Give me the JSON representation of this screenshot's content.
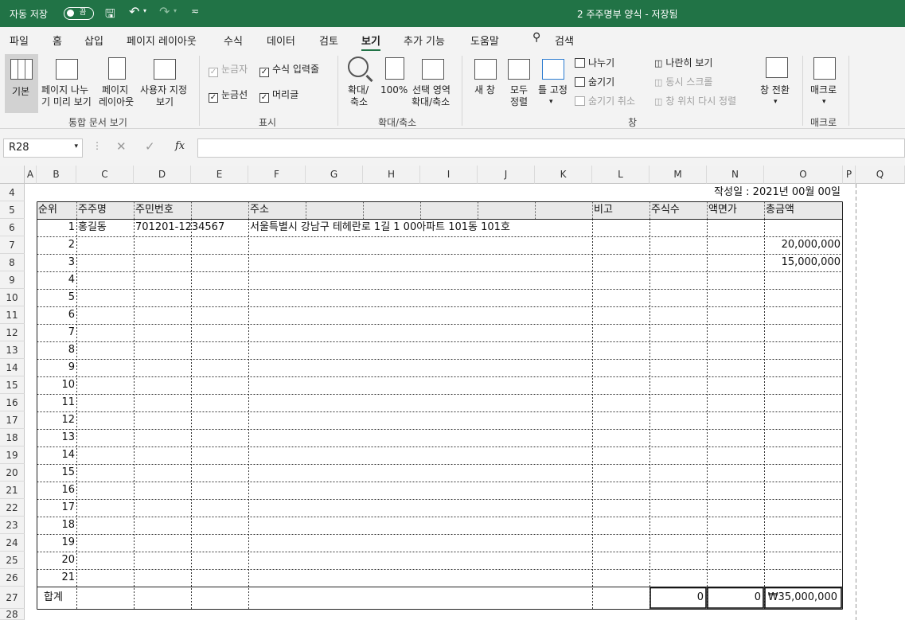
{
  "titlebar": {
    "autosave_label": "자동 저장",
    "toggle_state": "끔",
    "document_title": "2 주주명부 양식 - 저장됨"
  },
  "menu_tabs": [
    "파일",
    "홈",
    "삽입",
    "페이지 레이아웃",
    "수식",
    "데이터",
    "검토",
    "보기",
    "추가 기능",
    "도움말"
  ],
  "search_label": "검색",
  "active_tab": "보기",
  "ribbon": {
    "views": {
      "normal": "기본",
      "page_break": [
        "페이지 나누",
        "기 미리 보기"
      ],
      "page_layout": [
        "페이지",
        "레이아웃"
      ],
      "custom": [
        "사용자 지정",
        "보기"
      ],
      "group": "통합 문서 보기"
    },
    "show": {
      "ruler": "눈금자",
      "formula_bar": "수식 입력줄",
      "gridlines": "눈금선",
      "headings": "머리글",
      "group": "표시"
    },
    "zoom": {
      "zoom": [
        "확대/",
        "축소"
      ],
      "hundred": "100%",
      "selection": [
        "선택 영역",
        "확대/축소"
      ],
      "group": "확대/축소"
    },
    "window": {
      "new_window": "새 창",
      "arrange": [
        "모두",
        "정렬"
      ],
      "freeze": "틀 고정",
      "split": "나누기",
      "hide": "숨기기",
      "unhide": "숨기기 취소",
      "side_by_side": "나란히 보기",
      "sync_scroll": "동시 스크롤",
      "reset_pos": "창 위치 다시 정렬",
      "switch": "창 전환",
      "group": "창"
    },
    "macros": {
      "macro": "매크로",
      "group": "매크로"
    }
  },
  "formula_bar": {
    "name_box": "R28",
    "fx": "fx"
  },
  "columns": [
    "A",
    "B",
    "C",
    "D",
    "E",
    "F",
    "G",
    "H",
    "I",
    "J",
    "K",
    "L",
    "M",
    "N",
    "O",
    "P",
    "Q"
  ],
  "rows": [
    "4",
    "5",
    "6",
    "7",
    "8",
    "9",
    "10",
    "11",
    "12",
    "13",
    "14",
    "15",
    "16",
    "17",
    "18",
    "19",
    "20",
    "21",
    "22",
    "23",
    "24",
    "25",
    "26",
    "27",
    "28"
  ],
  "sheet": {
    "date_line": "작성일 : 2021년 00월 00일",
    "headers": {
      "no": "순위",
      "holder": "주주명",
      "id": "주민번호",
      "address": "주소",
      "note": "비고",
      "shares": "주식수",
      "face": "액면가",
      "amount": "총금액"
    },
    "row6": {
      "no": "1",
      "holder": "홍길동",
      "id": "701201-1234567",
      "address": "서울특별시 강남구 테헤란로 1길 1 00아파트 101동 101호"
    },
    "numbers": [
      "2",
      "3",
      "4",
      "5",
      "6",
      "7",
      "8",
      "9",
      "10",
      "11",
      "12",
      "13",
      "14",
      "15",
      "16",
      "17",
      "18",
      "19",
      "20",
      "21"
    ],
    "amount7": "20,000,000",
    "amount8": "15,000,000",
    "total": {
      "label": "합계",
      "shares": "0",
      "face": "0",
      "amount": "₩35,000,000"
    }
  }
}
